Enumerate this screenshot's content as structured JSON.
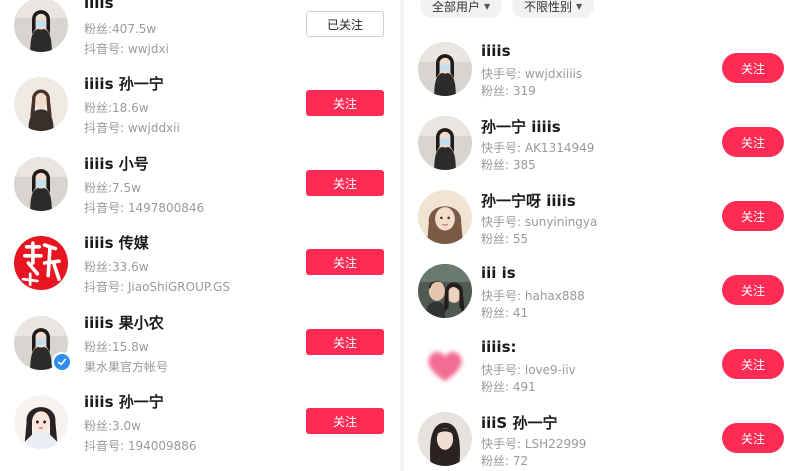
{
  "left_list": [
    {
      "name": "iiiis",
      "fans": "粉丝:407.5w",
      "account": "抖音号: wwjdxi",
      "button": "已关注",
      "followed": true,
      "avatar_icon": "girl-with-mask-photo",
      "verified": false
    },
    {
      "name": "iiiis 孙一宁",
      "fans": "粉丝:18.6w",
      "account": "抖音号: wwjddxii",
      "button": "关注",
      "followed": false,
      "avatar_icon": "girl-portrait-photo",
      "verified": false
    },
    {
      "name": "iiiis 小号",
      "fans": "粉丝:7.5w",
      "account": "抖音号: 1497800846",
      "button": "关注",
      "followed": false,
      "avatar_icon": "girl-with-mask-photo",
      "verified": false
    },
    {
      "name": "iiiis 传媒",
      "fans": "粉丝:33.6w",
      "account": "抖音号: JiaoShiGROUP.GS",
      "button": "关注",
      "followed": false,
      "avatar_icon": "red-calligraphy-logo",
      "verified": false
    },
    {
      "name": "iiiis 果小农",
      "fans": "粉丝:15.8w",
      "account": "果水果官方帐号",
      "button": "关注",
      "followed": false,
      "avatar_icon": "girl-with-mask-photo",
      "verified": true
    },
    {
      "name": "iiiis 孙一宁",
      "fans": "粉丝:3.0w",
      "account": "抖音号: 194009886",
      "button": "关注",
      "followed": false,
      "avatar_icon": "cartoon-girl-illustration",
      "verified": false
    }
  ],
  "right_filters": [
    {
      "label": "全部用户"
    },
    {
      "label": "不限性别"
    }
  ],
  "right_list": [
    {
      "name": "iiiis",
      "account": "快手号: wwjdxiiiis",
      "fans": "粉丝: 319",
      "button": "关注",
      "avatar_icon": "girl-with-mask-photo"
    },
    {
      "name": "孙一宁 iiiis",
      "account": "快手号: AK1314949",
      "fans": "粉丝: 385",
      "button": "关注",
      "avatar_icon": "girl-with-mask-photo"
    },
    {
      "name": "孙一宁呀 iiiis",
      "account": "快手号: sunyiningya",
      "fans": "粉丝: 55",
      "button": "关注",
      "avatar_icon": "girl-selfie-photo"
    },
    {
      "name": "iii is",
      "account": "快手号: hahax888",
      "fans": "粉丝: 41",
      "button": "关注",
      "avatar_icon": "couple-photo"
    },
    {
      "name": "iiiis:",
      "account": "快手号: love9-iiv",
      "fans": "粉丝: 491",
      "button": "关注",
      "avatar_icon": "blurred-pink-heart"
    },
    {
      "name": "iiiS 孙一宁",
      "account": "快手号: LSH22999",
      "fans": "粉丝: 72",
      "button": "关注",
      "avatar_icon": "girl-long-hair-photo"
    }
  ],
  "colors": {
    "accent": "#fe2c55",
    "verified": "#2e8ff0",
    "meta_text": "#9a9a9a"
  }
}
